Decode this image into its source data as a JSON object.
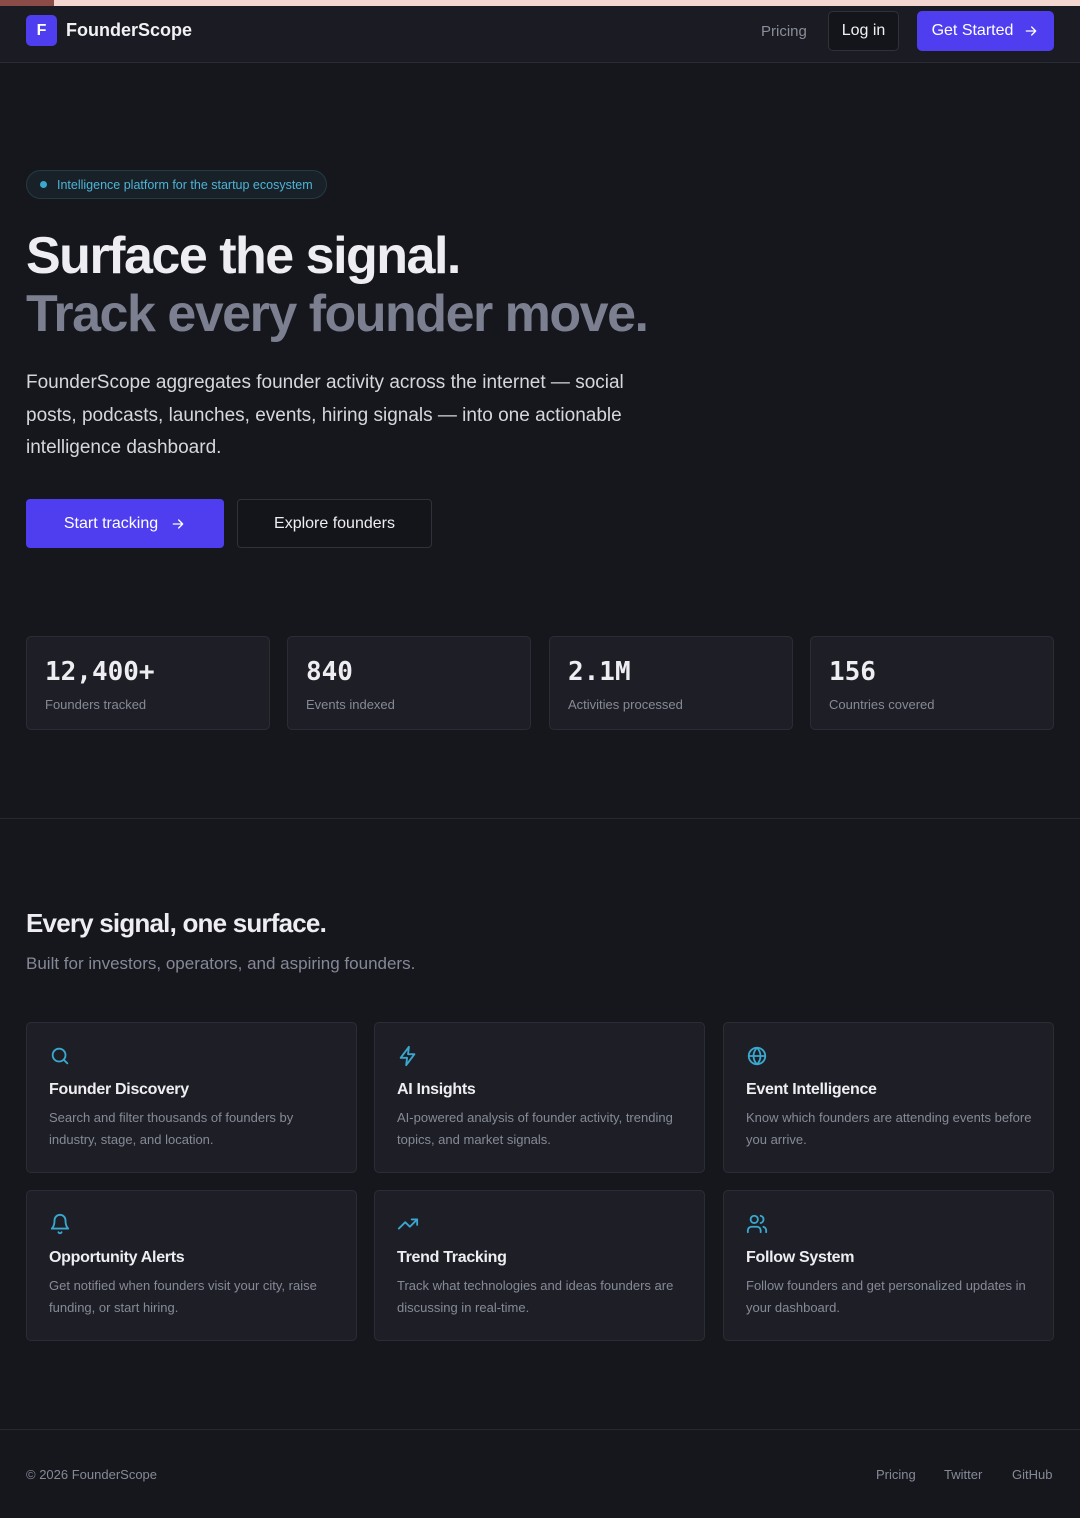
{
  "colors": {
    "accent": "#4f3ef0",
    "cyan": "#3aa7cf",
    "background": "#16171d",
    "card": "#1e1f26"
  },
  "header": {
    "logo_letter": "F",
    "brand": "FounderScope",
    "nav_pricing": "Pricing",
    "login": "Log in",
    "get_started": "Get Started"
  },
  "hero": {
    "badge": "Intelligence platform for the startup ecosystem",
    "title_line1": "Surface the signal.",
    "title_line2": "Track every founder move.",
    "description": "FounderScope aggregates founder activity across the internet — social posts, podcasts, launches, events, hiring signals — into one actionable intelligence dashboard.",
    "primary_cta": "Start tracking",
    "secondary_cta": "Explore founders"
  },
  "stats": [
    {
      "value": "12,400+",
      "label": "Founders tracked"
    },
    {
      "value": "840",
      "label": "Events indexed"
    },
    {
      "value": "2.1M",
      "label": "Activities processed"
    },
    {
      "value": "156",
      "label": "Countries covered"
    }
  ],
  "features": {
    "title": "Every signal, one surface.",
    "subtitle": "Built for investors, operators, and aspiring founders.",
    "items": [
      {
        "icon": "search-icon",
        "title": "Founder Discovery",
        "desc": "Search and filter thousands of founders by industry, stage, and location."
      },
      {
        "icon": "zap-icon",
        "title": "AI Insights",
        "desc": "AI-powered analysis of founder activity, trending topics, and market signals."
      },
      {
        "icon": "globe-icon",
        "title": "Event Intelligence",
        "desc": "Know which founders are attending events before you arrive."
      },
      {
        "icon": "bell-icon",
        "title": "Opportunity Alerts",
        "desc": "Get notified when founders visit your city, raise funding, or start hiring."
      },
      {
        "icon": "trending-up-icon",
        "title": "Trend Tracking",
        "desc": "Track what technologies and ideas founders are discussing in real-time."
      },
      {
        "icon": "users-icon",
        "title": "Follow System",
        "desc": "Follow founders and get personalized updates in your dashboard."
      }
    ]
  },
  "footer": {
    "copyright": "© 2026 FounderScope",
    "links": [
      "Pricing",
      "Twitter",
      "GitHub"
    ]
  }
}
